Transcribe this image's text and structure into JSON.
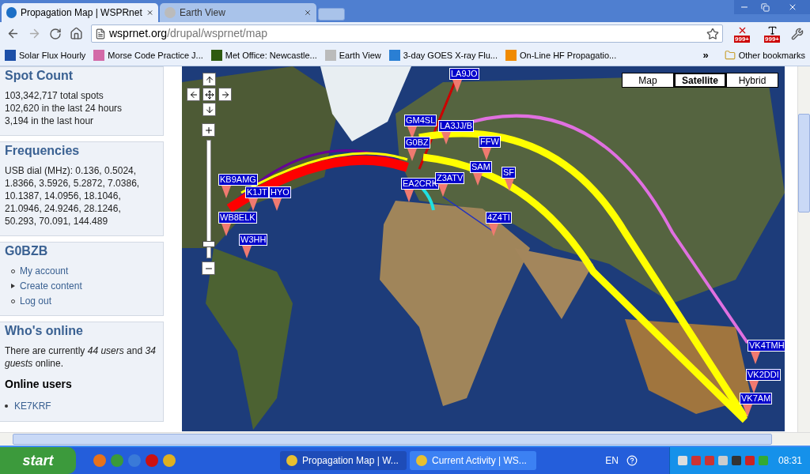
{
  "tabs": [
    {
      "title": "Propagation Map | WSPRnet",
      "selected": true
    },
    {
      "title": "Earth View",
      "selected": false
    }
  ],
  "address": {
    "host": "wsprnet.org",
    "path": "/drupal/wsprnet/map"
  },
  "extension_badges": [
    "999+",
    "999+"
  ],
  "bookmarks": [
    "Solar Flux Hourly",
    "Morse Code Practice J...",
    "Met Office: Newcastle...",
    "Earth View",
    "3-day GOES X-ray Flu...",
    "On-Line HF Propagatio..."
  ],
  "bookmarks_overflow": "»",
  "other_bookmarks": "Other bookmarks",
  "sidebar": [
    {
      "title": "Spot Count",
      "kind": "lines",
      "lines": [
        "103,342,717 total spots",
        "102,620 in the last 24 hours",
        "3,194 in the last hour"
      ]
    },
    {
      "title": "Frequencies",
      "kind": "text",
      "text": "USB dial (MHz): 0.136, 0.5024, 1.8366, 3.5926, 5.2872, 7.0386, 10.1387, 14.0956, 18.1046, 21.0946, 24.9246, 28.1246, 50.293, 70.091, 144.489"
    },
    {
      "title": "G0BZB",
      "kind": "menu",
      "items": [
        {
          "label": "My account",
          "expanded": false,
          "children_hidden": false
        },
        {
          "label": "Create content",
          "expanded": false,
          "children_hidden": true
        },
        {
          "label": "Log out",
          "expanded": false,
          "children_hidden": false
        }
      ]
    },
    {
      "title": "Who's online",
      "kind": "online",
      "text": "There are currently *44 users* and *34 guests* online.",
      "subtitle": "Online users",
      "users": [
        "KE7KRF"
      ]
    }
  ],
  "map": {
    "zoom": {
      "level": 0.1
    },
    "types": [
      {
        "label": "Map",
        "selected": false
      },
      {
        "label": "Satellite",
        "selected": true
      },
      {
        "label": "Hybrid",
        "selected": false
      }
    ],
    "markers": [
      "LA9JO",
      "GM4SL",
      "LA3JJ/B",
      "G0BZ",
      "EA2CRK",
      "Z3ATV",
      "4Z4TI",
      "VK4TMH",
      "VK2DDI",
      "VK7AM",
      "KB9AMG",
      "K1JT",
      "HYO",
      "WB8ELK",
      "W3HH",
      "FFW",
      "SAM",
      "SF"
    ]
  },
  "taskbar": {
    "start": "start",
    "tasks": [
      {
        "label": "Propagation Map | W...",
        "selected": true
      },
      {
        "label": "Current Activity | WS...",
        "selected": false
      }
    ],
    "language": "EN",
    "clock": "08:31"
  }
}
